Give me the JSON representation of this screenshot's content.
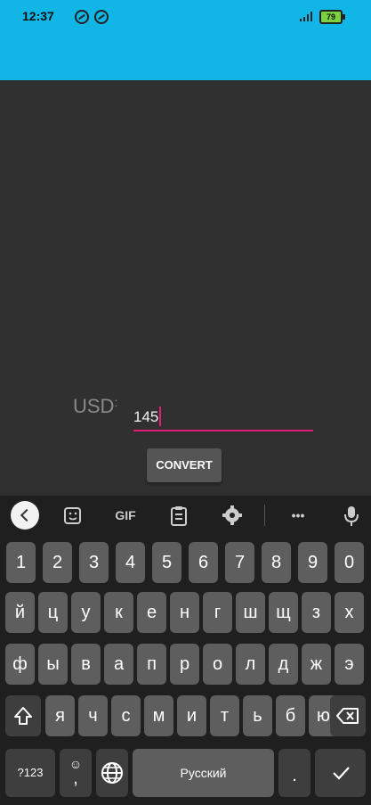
{
  "status_bar": {
    "time": "12:37",
    "battery": "79",
    "accent": "#12b6e6"
  },
  "form": {
    "currency_label": "USD",
    "colon": ":",
    "amount_value": "145",
    "convert_label": "CONVERT",
    "underline_color": "#e01e78"
  },
  "keyboard": {
    "toolbar": {
      "back": "back-icon",
      "sticker": "sticker-icon",
      "gif": "GIF",
      "clipboard": "clipboard-icon",
      "settings": "gear-icon",
      "more": "•••",
      "mic": "microphone-icon"
    },
    "number_row": [
      "1",
      "2",
      "3",
      "4",
      "5",
      "6",
      "7",
      "8",
      "9",
      "0"
    ],
    "row1": [
      "й",
      "ц",
      "у",
      "к",
      "е",
      "н",
      "г",
      "ш",
      "щ",
      "з",
      "х"
    ],
    "row2": [
      "ф",
      "ы",
      "в",
      "а",
      "п",
      "р",
      "о",
      "л",
      "д",
      "ж",
      "э"
    ],
    "row3": [
      "я",
      "ч",
      "с",
      "м",
      "и",
      "т",
      "ь",
      "б",
      "ю"
    ],
    "symbols_label": "?123",
    "comma": ",",
    "emoji": "☺",
    "globe": "globe-icon",
    "space_label": "Русский",
    "period": ".",
    "shift": "shift-icon",
    "backspace": "backspace-icon",
    "enter": "check-icon"
  }
}
